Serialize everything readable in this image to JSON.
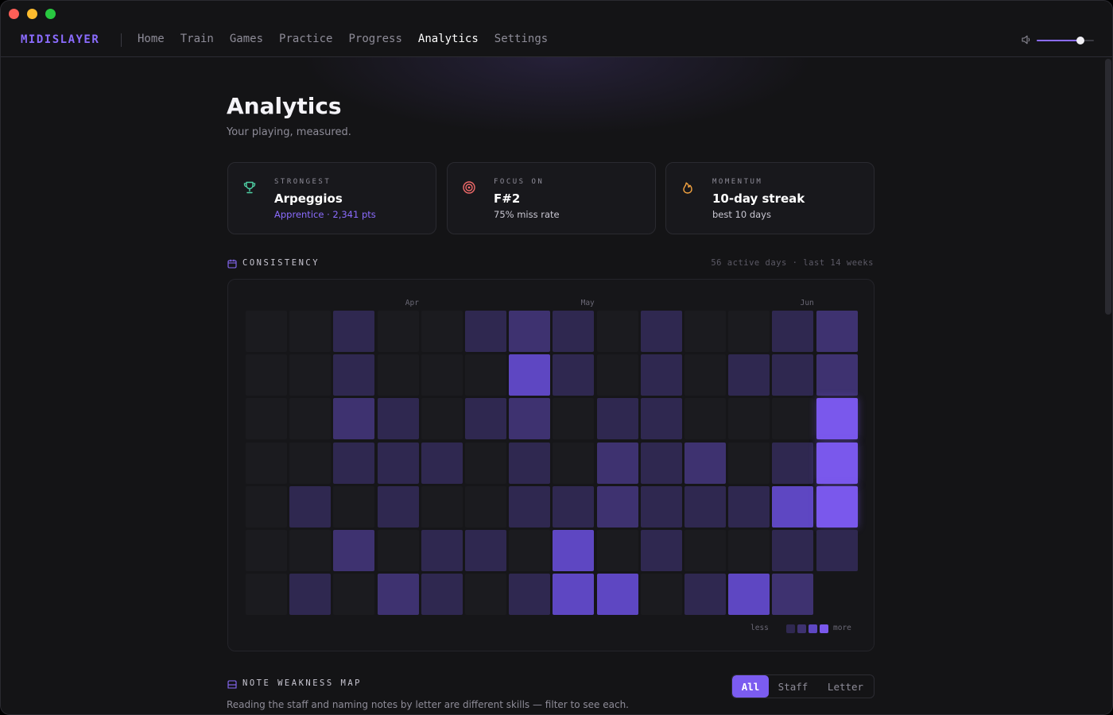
{
  "app": {
    "brand": "MIDISLAYER",
    "nav": [
      {
        "label": "Home",
        "active": false
      },
      {
        "label": "Train",
        "active": false
      },
      {
        "label": "Games",
        "active": false
      },
      {
        "label": "Practice",
        "active": false
      },
      {
        "label": "Progress",
        "active": false
      },
      {
        "label": "Analytics",
        "active": true
      },
      {
        "label": "Settings",
        "active": false
      }
    ],
    "volume": 0.77
  },
  "page": {
    "title": "Analytics",
    "subtitle": "Your playing, measured."
  },
  "cards": [
    {
      "label": "STRONGEST",
      "value": "Arpeggios",
      "detail": "Apprentice · 2,341 pts",
      "icon": "trophy-icon"
    },
    {
      "label": "FOCUS ON",
      "value": "F#2",
      "detail": "75% miss rate",
      "icon": "target-icon"
    },
    {
      "label": "MOMENTUM",
      "value": "10-day streak",
      "detail": "best 10 days",
      "icon": "flame-icon"
    }
  ],
  "consistency": {
    "heading": "CONSISTENCY",
    "meta": "56 active days · last 14 weeks",
    "months": [
      {
        "label": "Apr",
        "week": 4
      },
      {
        "label": "May",
        "week": 8
      },
      {
        "label": "Jun",
        "week": 13
      }
    ],
    "grid_weeks_by_day": [
      [
        0,
        0,
        1,
        0,
        0,
        1,
        2,
        1,
        0,
        1,
        0,
        0,
        1,
        2
      ],
      [
        0,
        0,
        1,
        0,
        0,
        0,
        3,
        1,
        0,
        1,
        0,
        1,
        1,
        2
      ],
      [
        0,
        0,
        2,
        1,
        0,
        1,
        2,
        0,
        1,
        1,
        0,
        0,
        0,
        4
      ],
      [
        0,
        0,
        1,
        1,
        1,
        0,
        1,
        0,
        2,
        1,
        2,
        0,
        1,
        4
      ],
      [
        0,
        1,
        0,
        1,
        0,
        0,
        1,
        1,
        2,
        1,
        1,
        1,
        3,
        4
      ],
      [
        0,
        0,
        2,
        0,
        1,
        1,
        0,
        3,
        0,
        1,
        0,
        0,
        1,
        1
      ],
      [
        0,
        1,
        0,
        2,
        1,
        0,
        1,
        3,
        3,
        0,
        1,
        3,
        2,
        -1
      ]
    ],
    "legend_less": "less",
    "legend_more": "more"
  },
  "weakness": {
    "heading": "NOTE WEAKNESS MAP",
    "description": "Reading the staff and naming notes by letter are different skills — filter to see each.",
    "filters": [
      {
        "label": "All",
        "active": true
      },
      {
        "label": "Staff",
        "active": false
      },
      {
        "label": "Letter",
        "active": false
      }
    ]
  },
  "colors": {
    "accent": "#8b6cff",
    "level_colors": [
      "#1b1b1f",
      "#2f2850",
      "#3e3270",
      "#5e47c2",
      "#7a58ec"
    ]
  }
}
